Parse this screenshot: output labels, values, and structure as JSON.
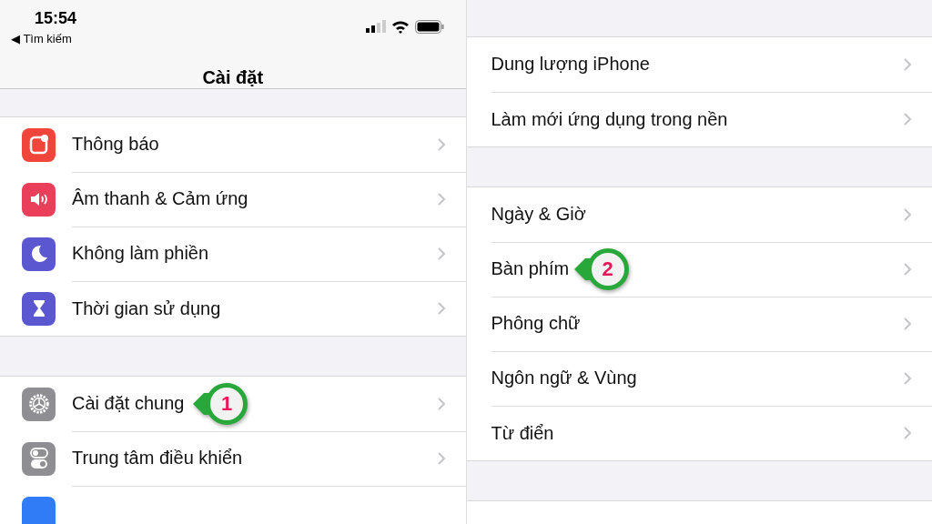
{
  "status_bar": {
    "time": "15:54",
    "back_link": "◀ Tìm kiếm"
  },
  "nav": {
    "title": "Cài đặt"
  },
  "left_groups": [
    {
      "items": [
        {
          "label": "Thông báo",
          "kind": "notifications",
          "color": "#f0453a"
        },
        {
          "label": "Âm thanh & Cảm ứng",
          "kind": "sound",
          "color": "#ea3f5a"
        },
        {
          "label": "Không làm phiền",
          "kind": "moon",
          "color": "#5b57d0"
        },
        {
          "label": "Thời gian sử dụng",
          "kind": "hourglass",
          "color": "#5b57d0"
        }
      ]
    },
    {
      "items": [
        {
          "label": "Cài đặt chung",
          "kind": "gear",
          "color": "#8e8e93",
          "callout": "1"
        },
        {
          "label": "Trung tâm điều khiển",
          "kind": "toggles",
          "color": "#8e8e93"
        },
        {
          "kind": "blank",
          "color": "#2f7cf6"
        }
      ]
    }
  ],
  "right_groups": [
    {
      "items": [
        {
          "label": "Dung lượng iPhone"
        },
        {
          "label": "Làm mới ứng dụng trong nền"
        }
      ]
    },
    {
      "items": [
        {
          "label": "Ngày & Giờ"
        },
        {
          "label": "Bàn phím",
          "callout": "2"
        },
        {
          "label": "Phông chữ"
        },
        {
          "label": "Ngôn ngữ & Vùng"
        },
        {
          "label": "Từ điển"
        }
      ]
    },
    {
      "kind": "cut"
    }
  ]
}
